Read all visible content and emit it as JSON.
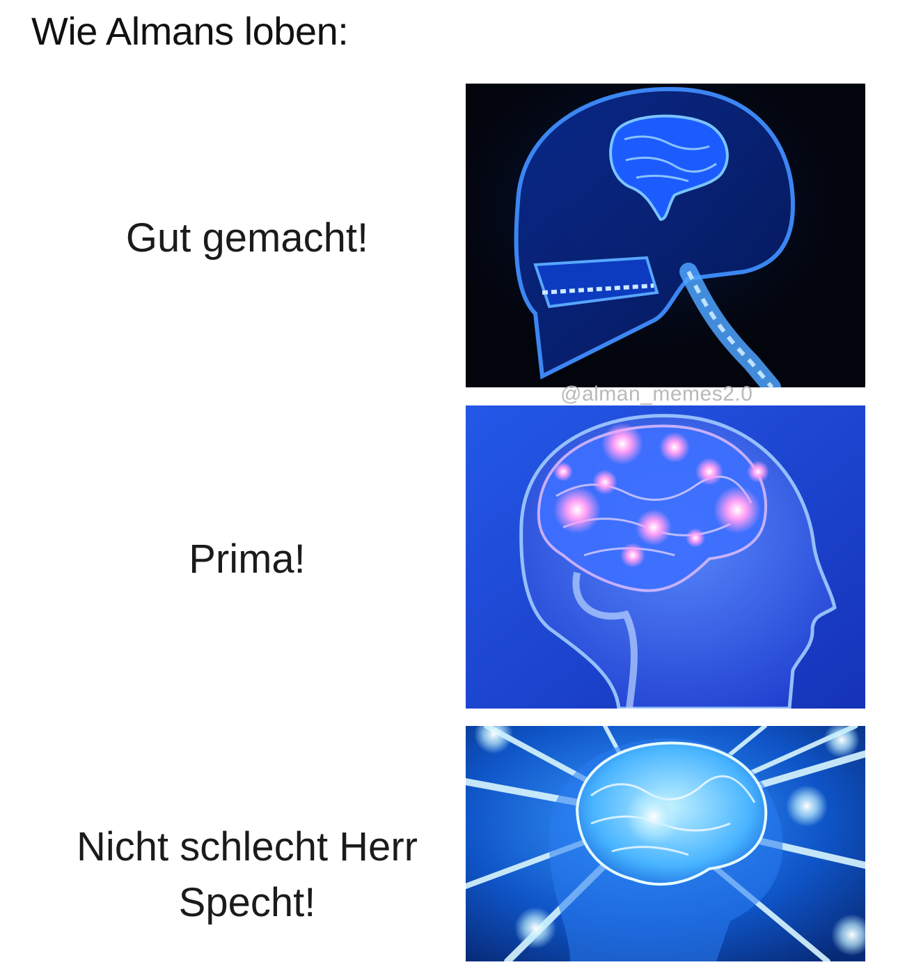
{
  "title": "Wie Almans loben:",
  "watermark": "@alman_memes2.0",
  "rows": [
    {
      "caption": "Gut gemacht!",
      "image": "xray-skull-brain-image"
    },
    {
      "caption": "Prima!",
      "image": "glowing-brain-head-image"
    },
    {
      "caption": "Nicht schlecht Herr Specht!",
      "image": "radiating-brain-image"
    }
  ],
  "colors": {
    "background": "#ffffff",
    "panel_dark": "#05070f",
    "brain_blue": "#2f7bff",
    "panel_mid_blue": "#2148d8",
    "glow_pink": "#ff8cf0",
    "ray_cyan": "#9fe6ff"
  }
}
